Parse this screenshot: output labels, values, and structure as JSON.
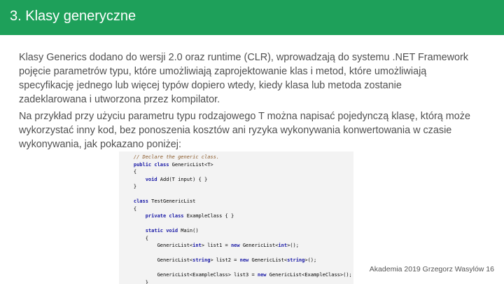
{
  "slide": {
    "title": "3. Klasy generyczne",
    "paragraph1": [
      "Klasy Generics dodano do wersji 2.0 oraz runtime (CLR), wprowadzają do systemu .NET Framework",
      "pojęcie parametrów typu, które umożliwiają zaprojektowanie klas i metod, które umożliwiają",
      "specyfikację jednego lub więcej typów dopiero wtedy, kiedy klasa lub metoda zostanie",
      "zadeklarowana i utworzona przez kompilator."
    ],
    "paragraph2": [
      "Na przykład przy użyciu parametru typu rodzajowego T można napisać pojedynczą klasę, którą może",
      "wykorzystać inny kod, bez ponoszenia kosztów ani ryzyka wykonywania konwertowania w czasie",
      "wykonywania, jak pokazano poniżej:"
    ],
    "code": {
      "lines": [
        {
          "pre": "    ",
          "comment": "// Declare the generic class."
        },
        {
          "pre": "    ",
          "kw1": "public class",
          "rest": " GenericList<T>"
        },
        {
          "pre": "    ",
          "rest": "{"
        },
        {
          "pre": "        ",
          "kw1": "void",
          "rest": " Add(T input) { }"
        },
        {
          "pre": "    ",
          "rest": "}"
        },
        {
          "pre": "",
          "rest": ""
        },
        {
          "pre": "    ",
          "kw1": "class",
          "rest": " TestGenericList"
        },
        {
          "pre": "    ",
          "rest": "{"
        },
        {
          "pre": "        ",
          "kw1": "private class",
          "rest": " ExampleClass { }"
        },
        {
          "pre": "",
          "rest": ""
        },
        {
          "pre": "        ",
          "kw1": "static void",
          "rest": " Main()"
        },
        {
          "pre": "        ",
          "rest": "{"
        },
        {
          "pre": "            ",
          "rest": "GenericList<int> list1 = new GenericList<int>();"
        },
        {
          "pre": "",
          "rest": ""
        },
        {
          "pre": "            ",
          "rest": "GenericList<string> list2 = new GenericList<string>();"
        },
        {
          "pre": "",
          "rest": ""
        },
        {
          "pre": "            ",
          "rest": "GenericList<ExampleClass> list3 = new GenericList<ExampleClass>();"
        },
        {
          "pre": "        ",
          "rest": "}"
        },
        {
          "pre": "    ",
          "rest": "}"
        }
      ]
    },
    "footer": "Akademia 2019 Grzegorz Wasylów 16"
  },
  "colors": {
    "header_bg": "#1ea05a",
    "header_text": "#ffffff",
    "body_text": "#505050",
    "code_bg": "#f3f3f3",
    "code_keyword": "#1a1aa6",
    "code_comment": "#8a5a2a"
  }
}
